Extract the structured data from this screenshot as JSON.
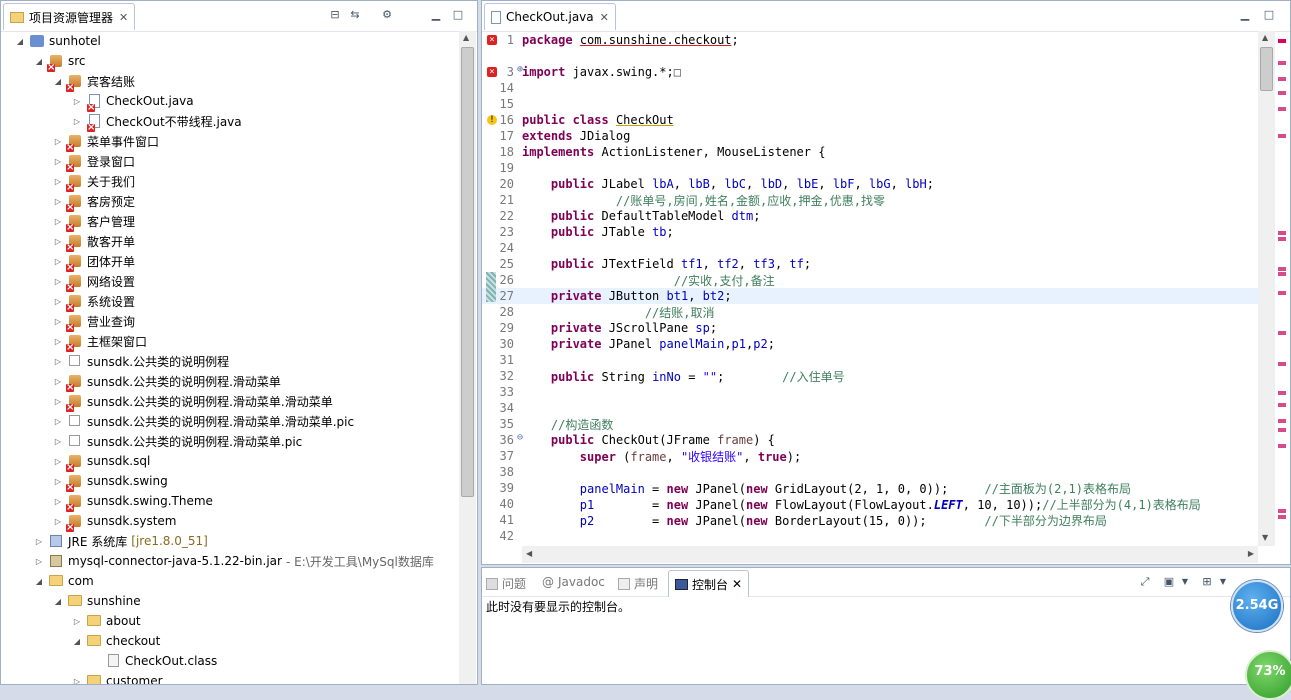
{
  "explorer": {
    "title": "项目资源管理器",
    "items": [
      {
        "label": "sunhotel",
        "depth": 0,
        "arrow": "down",
        "icon": "project-icon"
      },
      {
        "label": "src",
        "depth": 1,
        "arrow": "down",
        "icon": "source-folder-icon"
      },
      {
        "label": "宾客结账",
        "depth": 2,
        "arrow": "down",
        "icon": "package-error-icon"
      },
      {
        "label": "CheckOut.java",
        "depth": 3,
        "arrow": "right",
        "icon": "java-file-error-icon"
      },
      {
        "label": "CheckOut不带线程.java",
        "depth": 3,
        "arrow": "right",
        "icon": "java-file-error-icon"
      },
      {
        "label": "菜单事件窗口",
        "depth": 2,
        "arrow": "right",
        "icon": "package-error-icon"
      },
      {
        "label": "登录窗口",
        "depth": 2,
        "arrow": "right",
        "icon": "package-error-icon"
      },
      {
        "label": "关于我们",
        "depth": 2,
        "arrow": "right",
        "icon": "package-error-icon"
      },
      {
        "label": "客房预定",
        "depth": 2,
        "arrow": "right",
        "icon": "package-error-icon"
      },
      {
        "label": "客户管理",
        "depth": 2,
        "arrow": "right",
        "icon": "package-error-icon"
      },
      {
        "label": "散客开单",
        "depth": 2,
        "arrow": "right",
        "icon": "package-error-icon"
      },
      {
        "label": "团体开单",
        "depth": 2,
        "arrow": "right",
        "icon": "package-error-icon"
      },
      {
        "label": "网络设置",
        "depth": 2,
        "arrow": "right",
        "icon": "package-error-icon"
      },
      {
        "label": "系统设置",
        "depth": 2,
        "arrow": "right",
        "icon": "package-error-icon"
      },
      {
        "label": "营业查询",
        "depth": 2,
        "arrow": "right",
        "icon": "package-error-icon"
      },
      {
        "label": "主框架窗口",
        "depth": 2,
        "arrow": "right",
        "icon": "package-error-icon"
      },
      {
        "label": "sunsdk.公共类的说明例程",
        "depth": 2,
        "arrow": "right",
        "icon": "package-empty-icon"
      },
      {
        "label": "sunsdk.公共类的说明例程.滑动菜单",
        "depth": 2,
        "arrow": "right",
        "icon": "package-error-icon"
      },
      {
        "label": "sunsdk.公共类的说明例程.滑动菜单.滑动菜单",
        "depth": 2,
        "arrow": "right",
        "icon": "package-error-icon"
      },
      {
        "label": "sunsdk.公共类的说明例程.滑动菜单.滑动菜单.pic",
        "depth": 2,
        "arrow": "right",
        "icon": "package-empty-icon"
      },
      {
        "label": "sunsdk.公共类的说明例程.滑动菜单.pic",
        "depth": 2,
        "arrow": "right",
        "icon": "package-empty-icon"
      },
      {
        "label": "sunsdk.sql",
        "depth": 2,
        "arrow": "right",
        "icon": "package-error-icon"
      },
      {
        "label": "sunsdk.swing",
        "depth": 2,
        "arrow": "right",
        "icon": "package-error-icon"
      },
      {
        "label": "sunsdk.swing.Theme",
        "depth": 2,
        "arrow": "right",
        "icon": "package-error-icon"
      },
      {
        "label": "sunsdk.system",
        "depth": 2,
        "arrow": "right",
        "icon": "package-error-icon"
      },
      {
        "label": "JRE 系统库",
        "decor": "[jre1.8.0_51]",
        "depth": 1,
        "arrow": "right",
        "icon": "library-icon"
      },
      {
        "label": "mysql-connector-java-5.1.22-bin.jar",
        "decor2": "- E:\\开发工具\\MySql数据库",
        "depth": 1,
        "arrow": "right",
        "icon": "jar-icon"
      },
      {
        "label": "com",
        "depth": 1,
        "arrow": "down",
        "icon": "folder-icon"
      },
      {
        "label": "sunshine",
        "depth": 2,
        "arrow": "down",
        "icon": "folder-icon"
      },
      {
        "label": "about",
        "depth": 3,
        "arrow": "right",
        "icon": "folder-icon"
      },
      {
        "label": "checkout",
        "depth": 3,
        "arrow": "down",
        "icon": "folder-icon"
      },
      {
        "label": "CheckOut.class",
        "depth": 4,
        "arrow": "none",
        "icon": "class-file-icon"
      },
      {
        "label": "customer",
        "depth": 3,
        "arrow": "right",
        "icon": "folder-icon"
      }
    ]
  },
  "editor": {
    "tab_label": "CheckOut.java",
    "lines": [
      {
        "n": "1",
        "t": [
          [
            "kw",
            "package"
          ],
          [
            "p",
            " "
          ],
          [
            "u",
            "com.sunshine.checkout"
          ],
          [
            "p",
            ";"
          ]
        ],
        "mark": "err"
      },
      {
        "n": "",
        "t": []
      },
      {
        "n": "3",
        "t": [
          [
            "kw",
            "import"
          ],
          [
            "p",
            " javax.swing.*;"
          ],
          [
            "box",
            "□"
          ]
        ],
        "mark": "err",
        "fold": "+"
      },
      {
        "n": "14",
        "t": []
      },
      {
        "n": "15",
        "t": []
      },
      {
        "n": "16",
        "t": [
          [
            "kw",
            "public class"
          ],
          [
            "p",
            " "
          ],
          [
            "uw",
            "CheckOut"
          ]
        ],
        "mark": "warn"
      },
      {
        "n": "17",
        "t": [
          [
            "kw",
            "extends"
          ],
          [
            "p",
            " JDialog"
          ]
        ]
      },
      {
        "n": "18",
        "t": [
          [
            "kw",
            "implements"
          ],
          [
            "p",
            " ActionListener, MouseListener {"
          ]
        ]
      },
      {
        "n": "19",
        "t": []
      },
      {
        "n": "20",
        "t": [
          [
            "p",
            "    "
          ],
          [
            "kw",
            "public"
          ],
          [
            "p",
            " JLabel "
          ],
          [
            "f",
            "lbA"
          ],
          [
            "p",
            ", "
          ],
          [
            "f",
            "lbB"
          ],
          [
            "p",
            ", "
          ],
          [
            "f",
            "lbC"
          ],
          [
            "p",
            ", "
          ],
          [
            "f",
            "lbD"
          ],
          [
            "p",
            ", "
          ],
          [
            "f",
            "lbE"
          ],
          [
            "p",
            ", "
          ],
          [
            "f",
            "lbF"
          ],
          [
            "p",
            ", "
          ],
          [
            "f",
            "lbG"
          ],
          [
            "p",
            ", "
          ],
          [
            "f",
            "lbH"
          ],
          [
            "p",
            ";"
          ]
        ]
      },
      {
        "n": "21",
        "t": [
          [
            "p",
            "             "
          ],
          [
            "c",
            "//账单号,房间,姓名,金额,应收,押金,优惠,找零"
          ]
        ]
      },
      {
        "n": "22",
        "t": [
          [
            "p",
            "    "
          ],
          [
            "kw",
            "public"
          ],
          [
            "p",
            " DefaultTableModel "
          ],
          [
            "f",
            "dtm"
          ],
          [
            "p",
            ";"
          ]
        ]
      },
      {
        "n": "23",
        "t": [
          [
            "p",
            "    "
          ],
          [
            "kw",
            "public"
          ],
          [
            "p",
            " JTable "
          ],
          [
            "f",
            "tb"
          ],
          [
            "p",
            ";"
          ]
        ]
      },
      {
        "n": "24",
        "t": []
      },
      {
        "n": "25",
        "t": [
          [
            "p",
            "    "
          ],
          [
            "kw",
            "public"
          ],
          [
            "p",
            " JTextField "
          ],
          [
            "f",
            "tf1"
          ],
          [
            "p",
            ", "
          ],
          [
            "f",
            "tf2"
          ],
          [
            "p",
            ", "
          ],
          [
            "f",
            "tf3"
          ],
          [
            "p",
            ", "
          ],
          [
            "f",
            "tf"
          ],
          [
            "p",
            ";"
          ]
        ]
      },
      {
        "n": "26",
        "t": [
          [
            "p",
            "                     "
          ],
          [
            "c",
            "//实收,支付,备注"
          ]
        ]
      },
      {
        "n": "27",
        "t": [
          [
            "p",
            "    "
          ],
          [
            "kw",
            "private"
          ],
          [
            "p",
            " JButton "
          ],
          [
            "f",
            "bt1"
          ],
          [
            "p",
            ", "
          ],
          [
            "f",
            "bt2"
          ],
          [
            "p",
            ";"
          ]
        ],
        "cur": true
      },
      {
        "n": "28",
        "t": [
          [
            "p",
            "                 "
          ],
          [
            "c",
            "//结账,取消"
          ]
        ]
      },
      {
        "n": "29",
        "t": [
          [
            "p",
            "    "
          ],
          [
            "kw",
            "private"
          ],
          [
            "p",
            " JScrollPane "
          ],
          [
            "f",
            "sp"
          ],
          [
            "p",
            ";"
          ]
        ]
      },
      {
        "n": "30",
        "t": [
          [
            "p",
            "    "
          ],
          [
            "kw",
            "private"
          ],
          [
            "p",
            " JPanel "
          ],
          [
            "f",
            "panelMain"
          ],
          [
            "p",
            ","
          ],
          [
            "f",
            "p1"
          ],
          [
            "p",
            ","
          ],
          [
            "f",
            "p2"
          ],
          [
            "p",
            ";"
          ]
        ]
      },
      {
        "n": "31",
        "t": []
      },
      {
        "n": "32",
        "t": [
          [
            "p",
            "    "
          ],
          [
            "kw",
            "public"
          ],
          [
            "p",
            " String "
          ],
          [
            "f",
            "inNo"
          ],
          [
            "p",
            " = "
          ],
          [
            "s",
            "\"\""
          ],
          [
            "p",
            ";        "
          ],
          [
            "c",
            "//入住单号"
          ]
        ]
      },
      {
        "n": "33",
        "t": []
      },
      {
        "n": "34",
        "t": []
      },
      {
        "n": "35",
        "t": [
          [
            "p",
            "    "
          ],
          [
            "c",
            "//构造函数"
          ]
        ]
      },
      {
        "n": "36",
        "t": [
          [
            "p",
            "    "
          ],
          [
            "kw",
            "public"
          ],
          [
            "p",
            " CheckOut(JFrame "
          ],
          [
            "pv",
            "frame"
          ],
          [
            "p",
            ") {"
          ]
        ],
        "fold": "-"
      },
      {
        "n": "37",
        "t": [
          [
            "p",
            "        "
          ],
          [
            "kw",
            "super"
          ],
          [
            "p",
            " ("
          ],
          [
            "pv",
            "frame"
          ],
          [
            "p",
            ", "
          ],
          [
            "s",
            "\"收银结账\""
          ],
          [
            "p",
            ", "
          ],
          [
            "kw",
            "true"
          ],
          [
            "p",
            ");"
          ]
        ]
      },
      {
        "n": "38",
        "t": []
      },
      {
        "n": "39",
        "t": [
          [
            "p",
            "        "
          ],
          [
            "f",
            "panelMain"
          ],
          [
            "p",
            " = "
          ],
          [
            "kw",
            "new"
          ],
          [
            "p",
            " JPanel("
          ],
          [
            "kw",
            "new"
          ],
          [
            "p",
            " GridLayout(2, 1, 0, 0));     "
          ],
          [
            "c",
            "//主面板为(2,1)表格布局"
          ]
        ]
      },
      {
        "n": "40",
        "t": [
          [
            "p",
            "        "
          ],
          [
            "f",
            "p1"
          ],
          [
            "p",
            "        = "
          ],
          [
            "kw",
            "new"
          ],
          [
            "p",
            " JPanel("
          ],
          [
            "kw",
            "new"
          ],
          [
            "p",
            " FlowLayout(FlowLayout."
          ],
          [
            "fi",
            "LEFT"
          ],
          [
            "p",
            ", 10, 10));"
          ],
          [
            "c",
            "//上半部分为(4,1)表格布局"
          ]
        ]
      },
      {
        "n": "41",
        "t": [
          [
            "p",
            "        "
          ],
          [
            "f",
            "p2"
          ],
          [
            "p",
            "        = "
          ],
          [
            "kw",
            "new"
          ],
          [
            "p",
            " JPanel("
          ],
          [
            "kw",
            "new"
          ],
          [
            "p",
            " BorderLayout(15, 0));        "
          ],
          [
            "c",
            "//下半部分为边界布局"
          ]
        ]
      },
      {
        "n": "42",
        "t": []
      }
    ]
  },
  "console": {
    "tabs": [
      "问题",
      "Javadoc",
      "声明",
      "控制台"
    ],
    "active_tab": "控制台",
    "message": "此时没有要显示的控制台。"
  },
  "badges": {
    "memory": "2.54G",
    "percent": "73%"
  },
  "colors": {
    "keyword": "#7f0055",
    "field": "#0000c0",
    "comment": "#3f7f5f",
    "string": "#2a00ff",
    "param": "#6a3e3e"
  }
}
